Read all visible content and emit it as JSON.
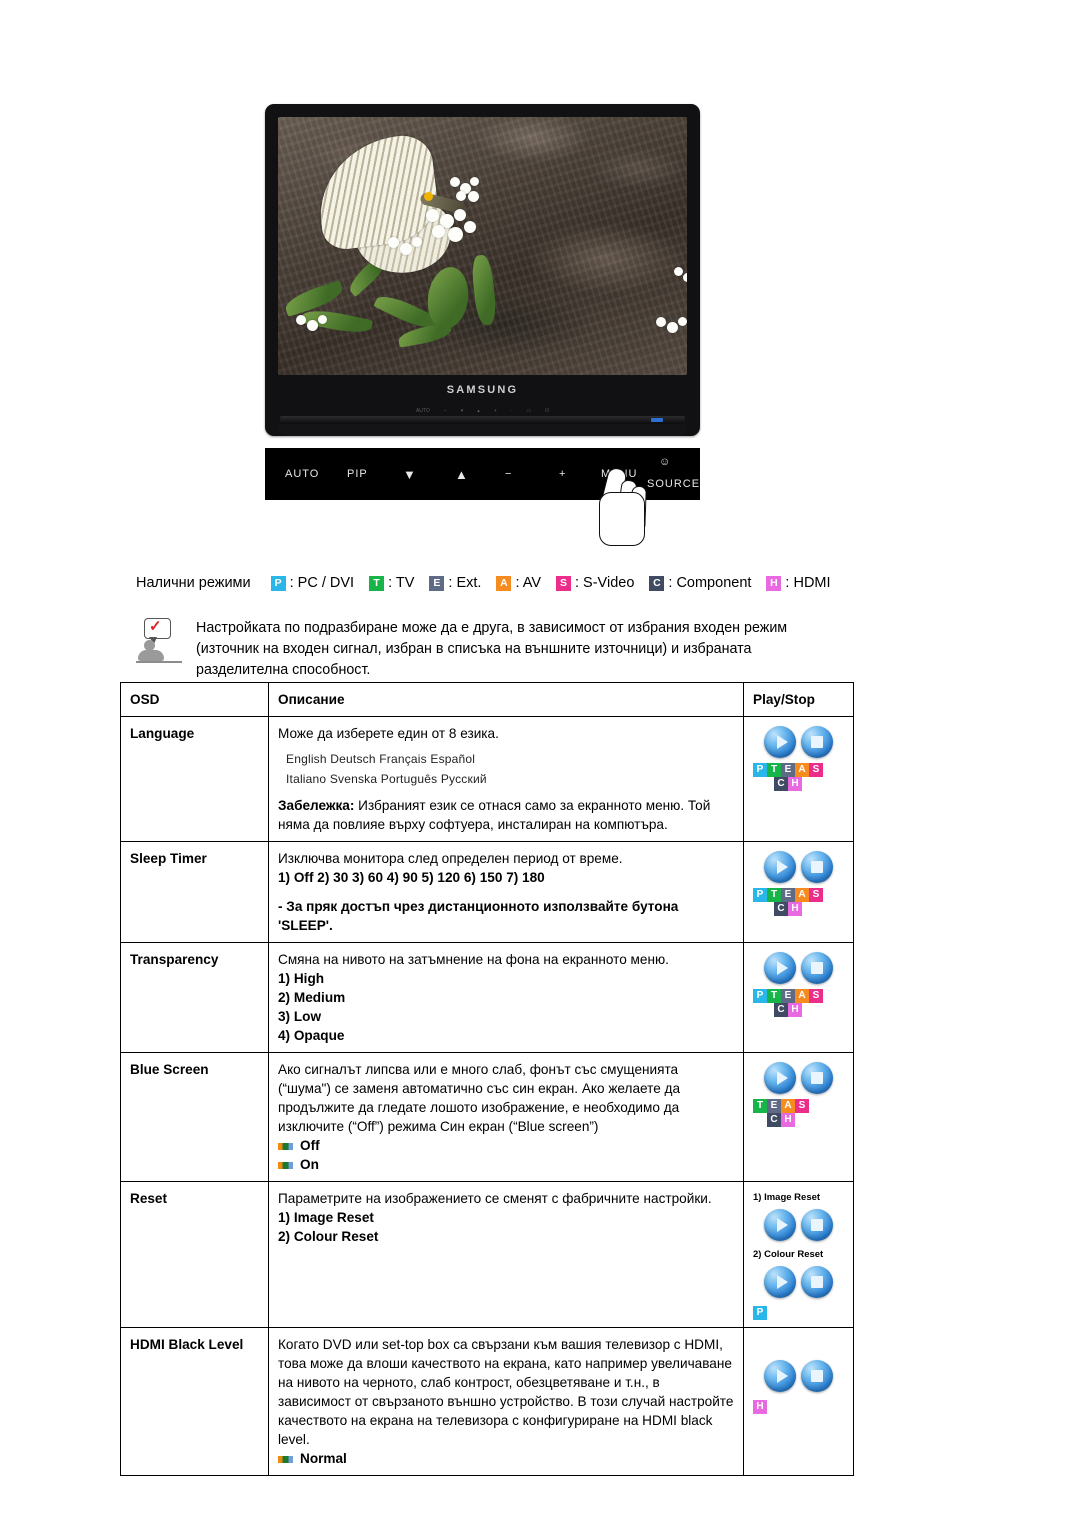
{
  "monitor": {
    "brand": "SAMSUNG",
    "control_buttons": [
      "AUTO",
      "PIP",
      "▼",
      "▲",
      "−",
      "+",
      "MENU",
      "SOURCE"
    ],
    "source_icon": "power-source-icon"
  },
  "modes": {
    "label": "Налични режими",
    "items": [
      {
        "badge": "P",
        "color": "#29b6e8",
        "text": ": PC / DVI"
      },
      {
        "badge": "T",
        "color": "#17b44a",
        "text": ": TV"
      },
      {
        "badge": "E",
        "color": "#5f6a86",
        "text": ": Ext."
      },
      {
        "badge": "A",
        "color": "#f68b1f",
        "text": ": AV"
      },
      {
        "badge": "S",
        "color": "#ec2e8a",
        "text": ": S-Video"
      },
      {
        "badge": "C",
        "color": "#3f4a63",
        "text": ": Component"
      },
      {
        "badge": "H",
        "color": "#e96ae0",
        "text": ": HDMI"
      }
    ]
  },
  "note": {
    "icon": "note-person-icon",
    "text": "Настройката по подразбиране може да е друга, в зависимост от избрания входен режим (източник на входен сигнал, избран в списъка на външните източници) и избраната разделителна способност."
  },
  "table": {
    "headers": [
      "OSD",
      "Описание",
      "Play/Stop"
    ],
    "rows": [
      {
        "osd": "Language",
        "desc_intro": "Може да изберете един от 8 езика.",
        "lang_line1": "English  Deutsch  Français  Español",
        "lang_line2": "Italiano  Svenska  Português  Русский",
        "note_label": "Забележка:",
        "note_body": " Избраният език се отнася само за екранното меню. Той няма да повлияе върху софтуера, инсталиран на компютъра.",
        "badges": [
          "P",
          "T",
          "E",
          "A",
          "S",
          "C",
          "H"
        ]
      },
      {
        "osd": "Sleep Timer",
        "desc_intro": "Изключва монитора след определен период от време.",
        "options_line": "1) Off    2) 30    3) 60    4) 90    5) 120    6) 150    7) 180",
        "extra": "- За пряк достъп чрез дистанционното използвайте бутона 'SLEEP'.",
        "badges": [
          "P",
          "T",
          "E",
          "A",
          "S",
          "C",
          "H"
        ]
      },
      {
        "osd": "Transparency",
        "desc_intro": "Смяна на нивото на затъмнение на фона на екранното меню.",
        "options": [
          "1) High",
          "2) Medium",
          "3) Low",
          "4) Opaque"
        ],
        "badges": [
          "P",
          "T",
          "E",
          "A",
          "S",
          "C",
          "H"
        ]
      },
      {
        "osd": "Blue Screen",
        "desc_intro": "Ако сигналът липсва или е много слаб, фонът със смущенията (“шума\") се заменя автоматично със син екран. Ако желаете да продължите да гледате лошото изображение, е необходимо да изключите (“Off”) режима Син екран (“Blue screen”)",
        "choices": [
          "Off",
          "On"
        ],
        "badges": [
          "T",
          "E",
          "A",
          "S",
          "C",
          "H"
        ]
      },
      {
        "osd": "Reset",
        "desc_intro": "Параметрите на изображението се сменят с фабричните настройки.",
        "options": [
          "1) Image Reset",
          "2) Colour Reset"
        ],
        "icon_label_1": "1) Image Reset",
        "icon_label_2": "2) Colour Reset",
        "badges": [
          "P"
        ]
      },
      {
        "osd": "HDMI Black Level",
        "desc_intro": "Когато DVD или set-top box са свързани към вашия телевизор с HDMI, това може да влоши качеството на екрана, като например увеличаване на нивото на черното, слаб контрост, обезцветяване и т.н., в зависимост от свързаното външно устройство. В този случай настройте качеството на екрана на телевизора с конфигуриране на HDMI black level.",
        "choices": [
          "Normal"
        ],
        "badges": [
          "H"
        ]
      }
    ]
  },
  "badge_colors": {
    "P": "#29b6e8",
    "T": "#17b44a",
    "E": "#5f6a86",
    "A": "#f68b1f",
    "S": "#ec2e8a",
    "C": "#3f4a63",
    "H": "#e96ae0"
  }
}
